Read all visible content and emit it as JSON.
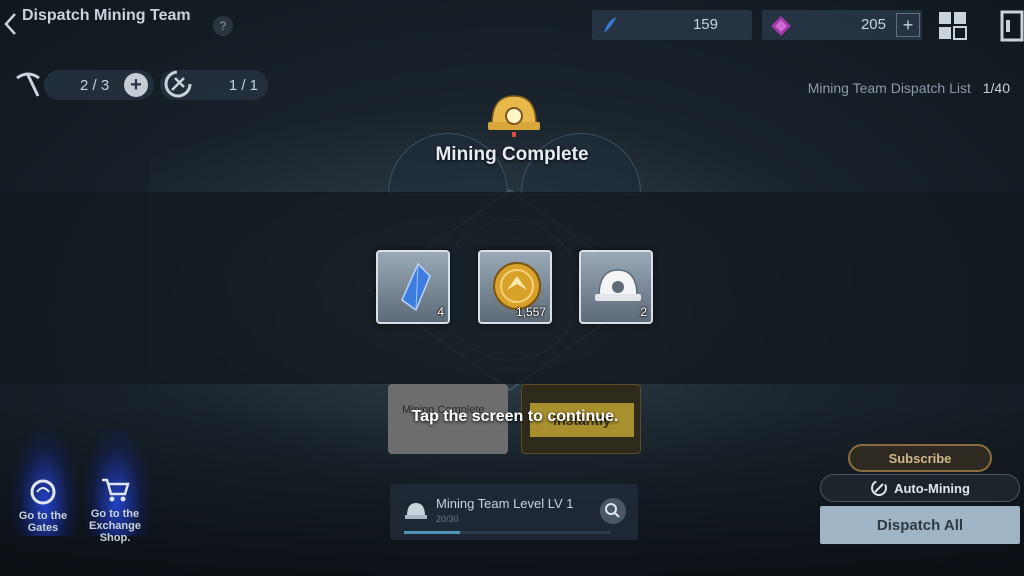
{
  "header": {
    "title": "Dispatch Mining Team",
    "help_label": "?",
    "currency_1": {
      "icon": "blue-feather-icon",
      "value": "159"
    },
    "currency_2": {
      "icon": "purple-gem-icon",
      "value": "205",
      "plus_label": "+"
    },
    "menu_icon": "grid-menu-icon",
    "exit_icon": "exit-door-icon"
  },
  "status": {
    "team_count": "2 / 3",
    "team_plus_label": "+",
    "auto_count": "1 / 1",
    "dispatch_list_label": "Mining Team Dispatch List",
    "dispatch_list_count": "1/40"
  },
  "modal": {
    "title": "Mining Complete",
    "rewards": [
      {
        "name": "blue-crystal-icon",
        "qty": "4"
      },
      {
        "name": "gold-coin-icon",
        "qty": "1,557"
      },
      {
        "name": "mining-helmet-icon",
        "qty": "2"
      }
    ],
    "continue_text": "Tap the screen to continue."
  },
  "cards": {
    "left_label": "Mining Complete",
    "right_button": "Instantly"
  },
  "bottom": {
    "gates_label": "Go to the Gates",
    "shop_label": "Go to the Exchange Shop.",
    "level_label": "Mining Team Level  LV 1",
    "level_sub": "20/30",
    "level_progress": 0.27,
    "subscribe_label": "Subscribe",
    "auto_mining_label": "Auto-Mining",
    "dispatch_all_label": "Dispatch All"
  },
  "colors": {
    "accent_gold": "#e8b84a",
    "dispatch_button": "#9fb4c4",
    "band": "#12181f"
  }
}
